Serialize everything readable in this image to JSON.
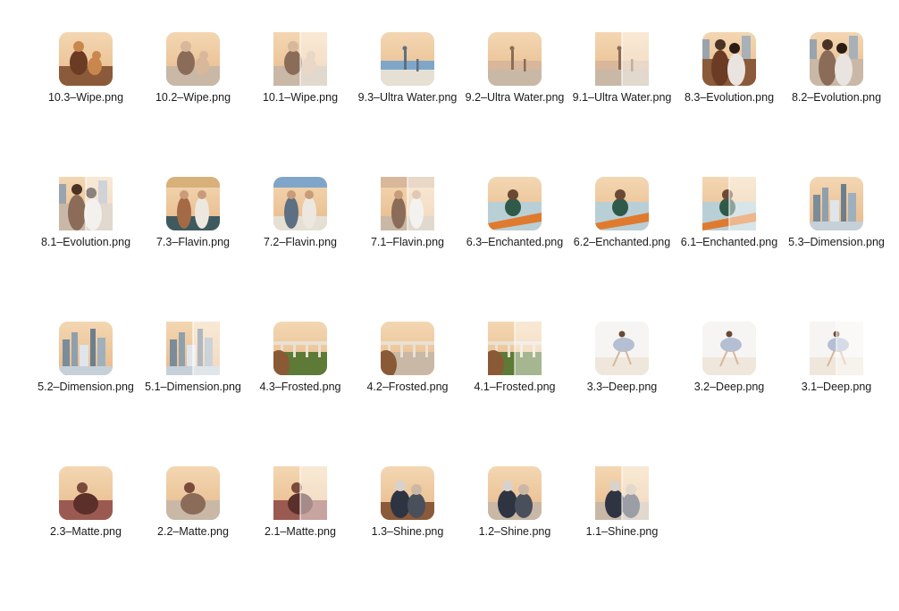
{
  "files": [
    {
      "name": "10.3–Wipe.png",
      "scene": "dog",
      "style": "warm",
      "wipe": false
    },
    {
      "name": "10.2–Wipe.png",
      "scene": "dog",
      "style": "light",
      "wipe": false
    },
    {
      "name": "10.1–Wipe.png",
      "scene": "dog",
      "style": "light",
      "wipe": true
    },
    {
      "name": "9.3–Ultra Water.png",
      "scene": "beach",
      "style": "cool",
      "wipe": false
    },
    {
      "name": "9.2–Ultra Water.png",
      "scene": "beach",
      "style": "light",
      "wipe": false
    },
    {
      "name": "9.1–Ultra Water.png",
      "scene": "beach",
      "style": "light",
      "wipe": true
    },
    {
      "name": "8.3–Evolution.png",
      "scene": "couple",
      "style": "warm",
      "wipe": false
    },
    {
      "name": "8.2–Evolution.png",
      "scene": "couple",
      "style": "light",
      "wipe": false
    },
    {
      "name": "8.1–Evolution.png",
      "scene": "couple",
      "style": "light",
      "wipe": true
    },
    {
      "name": "7.3–Flavin.png",
      "scene": "men",
      "style": "teal",
      "wipe": false
    },
    {
      "name": "7.2–Flavin.png",
      "scene": "men",
      "style": "cool",
      "wipe": false
    },
    {
      "name": "7.1–Flavin.png",
      "scene": "men",
      "style": "light",
      "wipe": true
    },
    {
      "name": "6.3–Enchanted.png",
      "scene": "kayak",
      "style": "warm",
      "wipe": false
    },
    {
      "name": "6.2–Enchanted.png",
      "scene": "kayak",
      "style": "light",
      "wipe": false
    },
    {
      "name": "6.1–Enchanted.png",
      "scene": "kayak",
      "style": "light",
      "wipe": true
    },
    {
      "name": "5.3–Dimension.png",
      "scene": "city",
      "style": "teal",
      "wipe": false
    },
    {
      "name": "5.2–Dimension.png",
      "scene": "city",
      "style": "cool",
      "wipe": false
    },
    {
      "name": "5.1–Dimension.png",
      "scene": "city",
      "style": "light",
      "wipe": true
    },
    {
      "name": "4.3–Frosted.png",
      "scene": "bridge",
      "style": "vivid",
      "wipe": false
    },
    {
      "name": "4.2–Frosted.png",
      "scene": "bridge",
      "style": "light",
      "wipe": false
    },
    {
      "name": "4.1–Frosted.png",
      "scene": "bridge",
      "style": "vivid",
      "wipe": true
    },
    {
      "name": "3.3–Deep.png",
      "scene": "dancer",
      "style": "light",
      "wipe": false
    },
    {
      "name": "3.2–Deep.png",
      "scene": "dancer",
      "style": "light",
      "wipe": false
    },
    {
      "name": "3.1–Deep.png",
      "scene": "dancer",
      "style": "light",
      "wipe": true
    },
    {
      "name": "2.3–Matte.png",
      "scene": "sitter",
      "style": "pink",
      "wipe": false
    },
    {
      "name": "2.2–Matte.png",
      "scene": "sitter",
      "style": "light",
      "wipe": false
    },
    {
      "name": "2.1–Matte.png",
      "scene": "sitter",
      "style": "pink",
      "wipe": true
    },
    {
      "name": "1.3–Shine.png",
      "scene": "old",
      "style": "warm",
      "wipe": false
    },
    {
      "name": "1.2–Shine.png",
      "scene": "old",
      "style": "light",
      "wipe": false
    },
    {
      "name": "1.1–Shine.png",
      "scene": "old",
      "style": "light",
      "wipe": true
    }
  ],
  "colors": {
    "background": "#ffffff",
    "label_text": "#1a1a1a"
  }
}
